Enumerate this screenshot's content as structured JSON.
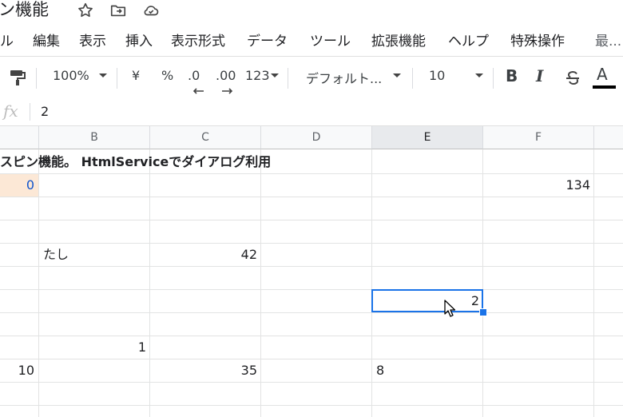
{
  "title": "ン機能",
  "menu": [
    "ル",
    "編集",
    "表示",
    "挿入",
    "表示形式",
    "データ",
    "ツール",
    "拡張機能",
    "ヘルプ",
    "特殊操作",
    "最..."
  ],
  "toolbar": {
    "zoom": "100%",
    "currency": "¥",
    "percent": "%",
    "decrease_decimal": ".0",
    "increase_decimal": ".00",
    "more_formats": "123",
    "font": "デフォルト...",
    "font_size": "10",
    "bold": "B",
    "italic": "I",
    "text_color": "A"
  },
  "formula_bar": {
    "fx": "fx",
    "value": "2"
  },
  "columns": [
    "B",
    "C",
    "D",
    "E",
    "F"
  ],
  "selected_column": "E",
  "cells": {
    "r1_title": "スピン機能。 HtmlServiceでダイアログ利用",
    "r2_a": "0",
    "r2_f": "134",
    "r5_b": "たし",
    "r5_c": "42",
    "r7_e": "2",
    "r9_b": "1",
    "r10_a": "10",
    "r10_c": "35",
    "r10_e": "8"
  },
  "colors": {
    "accent": "#1a73e8",
    "highlight_bg": "#fce8d6",
    "highlight_text": "#1155cc"
  }
}
